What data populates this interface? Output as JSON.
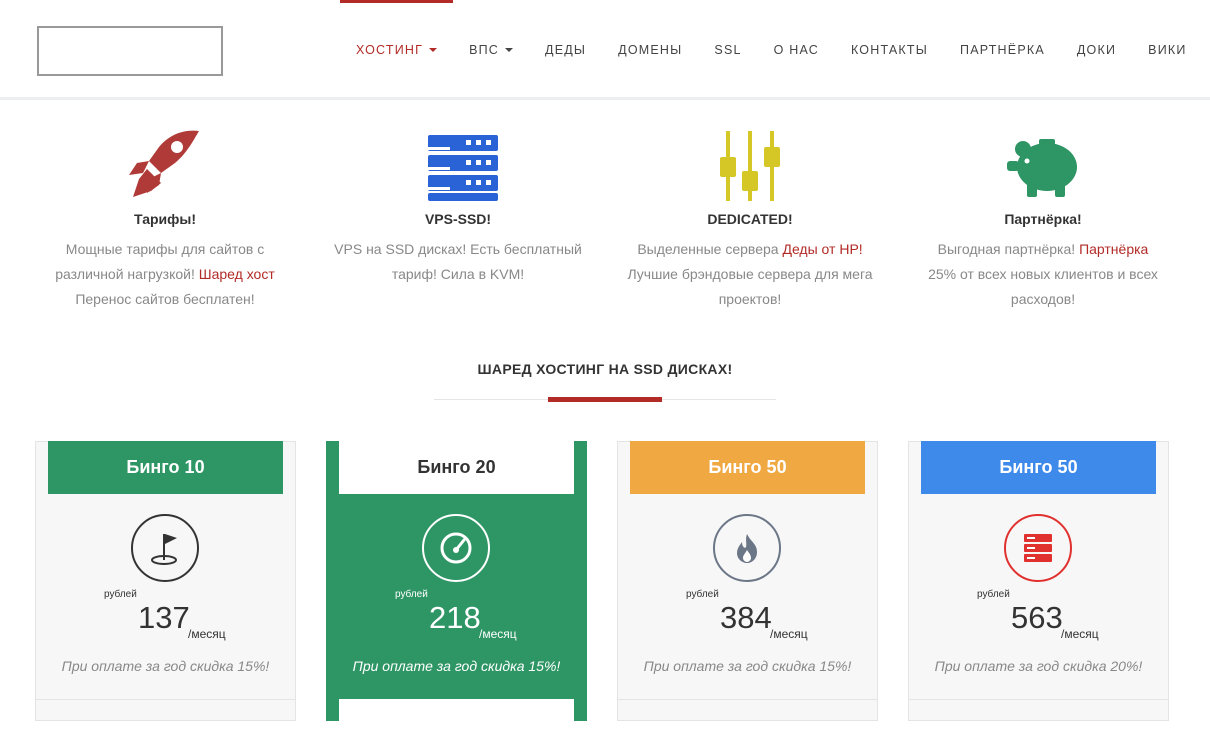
{
  "nav": {
    "items": [
      {
        "label": "ХОСТИНГ",
        "dropdown": true,
        "active": true
      },
      {
        "label": "ВПС",
        "dropdown": true,
        "active": false
      },
      {
        "label": "ДЕДЫ",
        "dropdown": false,
        "active": false
      },
      {
        "label": "ДОМЕНЫ",
        "dropdown": false,
        "active": false
      },
      {
        "label": "SSL",
        "dropdown": false,
        "active": false
      },
      {
        "label": "О НАС",
        "dropdown": false,
        "active": false
      },
      {
        "label": "КОНТАКТЫ",
        "dropdown": false,
        "active": false
      },
      {
        "label": "ПАРТНЁРКА",
        "dropdown": false,
        "active": false
      },
      {
        "label": "ДОКИ",
        "dropdown": false,
        "active": false
      },
      {
        "label": "ВИКИ",
        "dropdown": false,
        "active": false
      }
    ]
  },
  "features": [
    {
      "icon": "rocket-icon",
      "color": "#b03a37",
      "title": "Тарифы!",
      "text1": "Мощные тарифы для сайтов с различной нагрузкой!",
      "link": "Шаред хост",
      "text2": "Перенос сайтов бесплатен!"
    },
    {
      "icon": "server-icon",
      "color": "#2a63d6",
      "title": "VPS-SSD!",
      "text1": "VPS на SSD дисках! Есть бесплатный тариф! Сила в KVM!",
      "link": "",
      "text2": ""
    },
    {
      "icon": "sliders-icon",
      "color": "#d4c726",
      "title": "DEDICATED!",
      "text1": "Выделенные сервера",
      "link": "Деды от HP!",
      "text2": "Лучшие брэндовые сервера для мега проектов!"
    },
    {
      "icon": "piggy-bank-icon",
      "color": "#2e9565",
      "title": "Партнёрка!",
      "text1": "Выгодная партнёрка!",
      "link": "Партнёрка",
      "text2": "25% от всех новых клиентов и всех расходов!"
    }
  ],
  "section": {
    "title": "ШАРЕД ХОСТИНГ НА SSD ДИСКАХ!"
  },
  "plans": [
    {
      "name": "Бинго 10",
      "head_color": "#2e9565",
      "icon": "flag-icon",
      "icon_color": "#333333",
      "currency": "рублей",
      "price": "137",
      "period": "/месяц",
      "discount": "При оплате за год скидка 15%!",
      "featured": false
    },
    {
      "name": "Бинго 20",
      "head_color": "#ffffff",
      "icon": "speedometer-icon",
      "icon_color": "#ffffff",
      "currency": "рублей",
      "price": "218",
      "period": "/месяц",
      "discount": "При оплате за год скидка 15%!",
      "featured": true
    },
    {
      "name": "Бинго 50",
      "head_color": "#f0a843",
      "icon": "fire-icon",
      "icon_color": "#6b7686",
      "currency": "рублей",
      "price": "384",
      "period": "/месяц",
      "discount": "При оплате за год скидка 15%!",
      "featured": false
    },
    {
      "name": "Бинго 50",
      "head_color": "#3d8aeb",
      "icon": "database-icon",
      "icon_color": "#e0312f",
      "currency": "рублей",
      "price": "563",
      "period": "/месяц",
      "discount": "При оплате за год скидка 20%!",
      "featured": false
    }
  ]
}
